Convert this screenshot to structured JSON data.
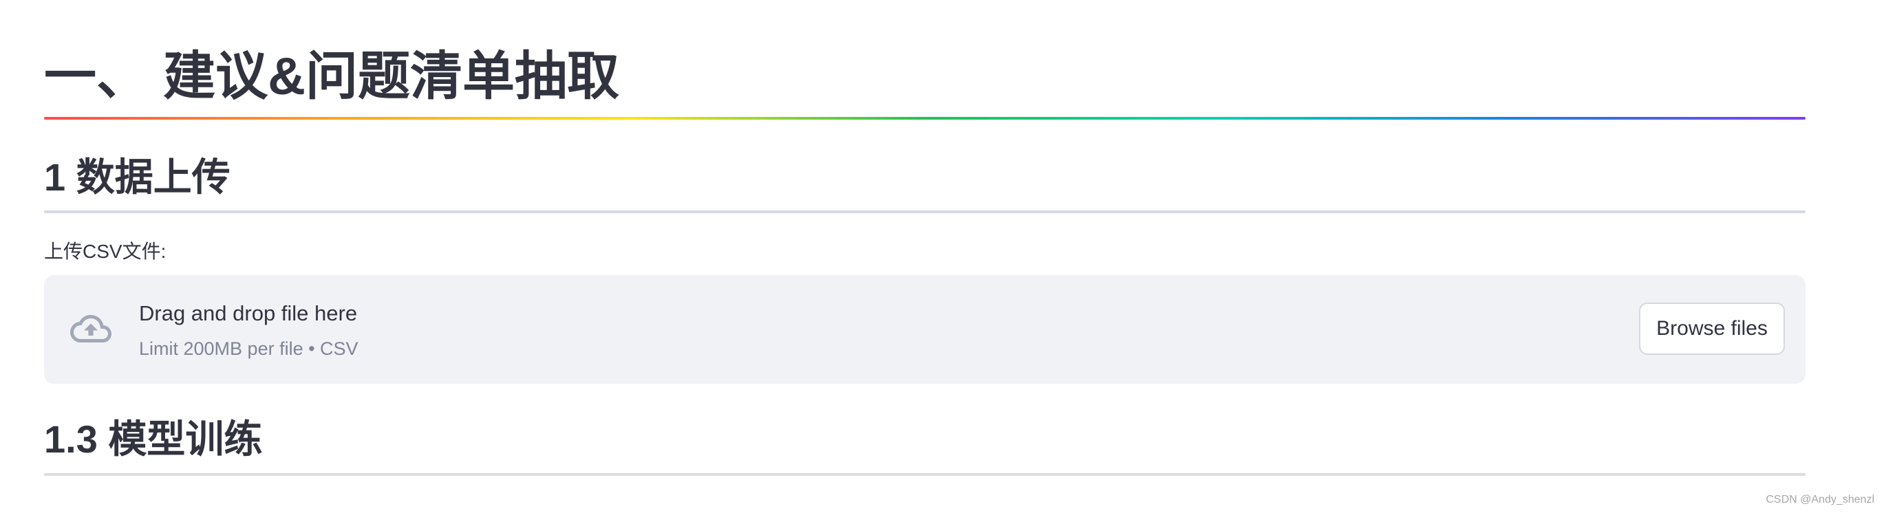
{
  "main": {
    "title": "一、 建议&问题清单抽取",
    "section1": "1 数据上传",
    "uploader": {
      "label": "上传CSV文件:",
      "dropzone_title": "Drag and drop file here",
      "dropzone_subtitle": "Limit 200MB per file • CSV",
      "browse_label": "Browse files",
      "icon": "cloud-upload-icon"
    },
    "section2": "1.3 模型训练"
  },
  "watermark": "CSDN @Andy_shenzl",
  "colors": {
    "text": "#31333f",
    "dropzone_bg": "#f0f2f6",
    "muted_text": "#808495",
    "icon": "#a3a8b8"
  }
}
